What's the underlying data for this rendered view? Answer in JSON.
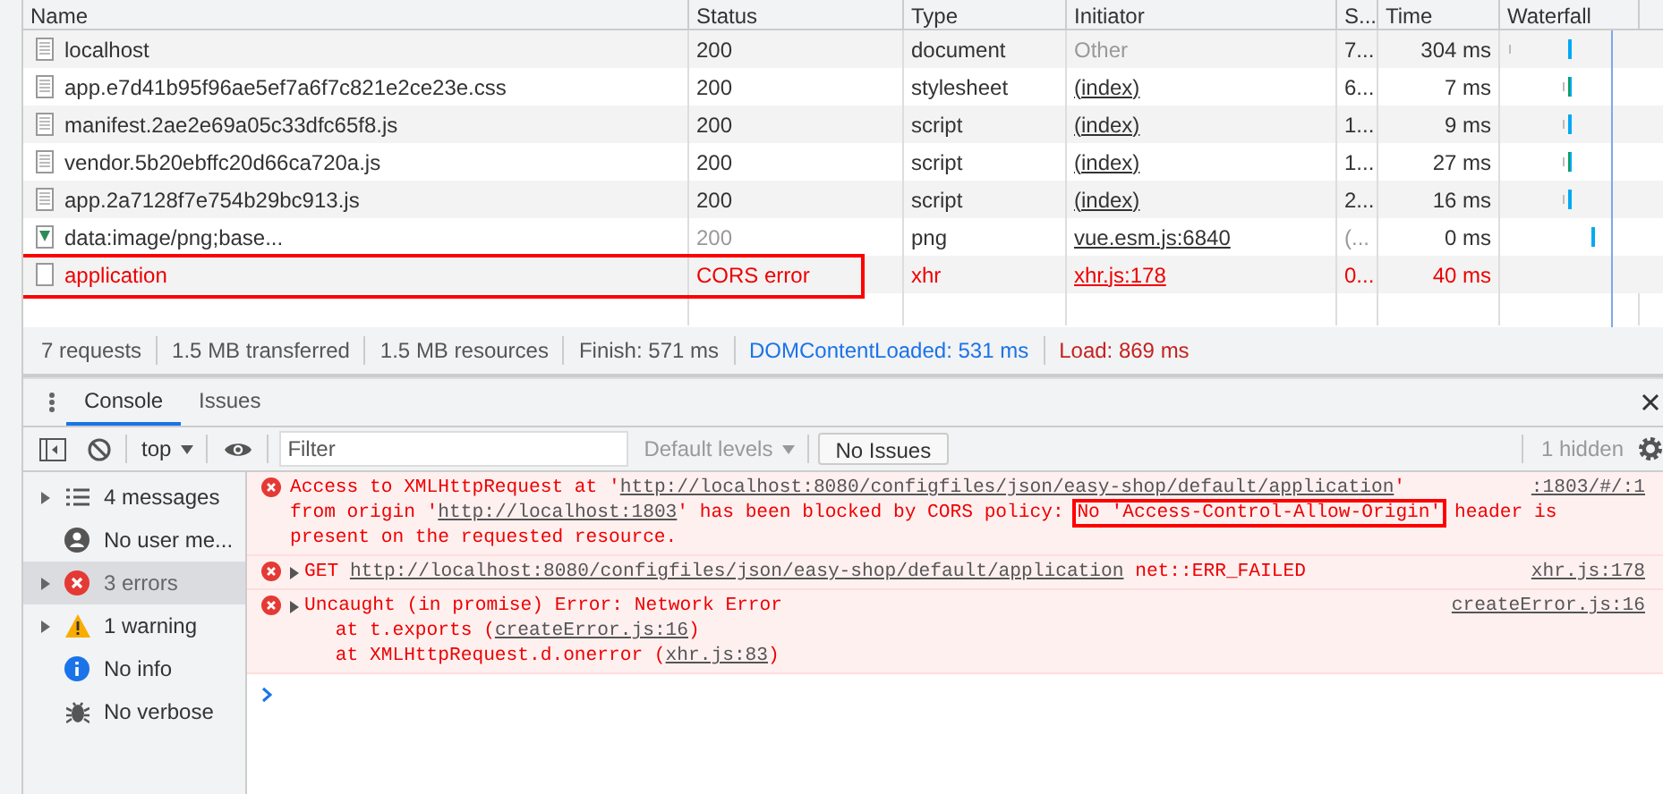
{
  "network": {
    "columns": [
      "Name",
      "Status",
      "Type",
      "Initiator",
      "S...",
      "Time",
      "Waterfall"
    ],
    "rows": [
      {
        "name": "localhost",
        "status": "200",
        "type": "document",
        "initiator": "Other",
        "initiator_link": false,
        "size": "7...",
        "time": "304 ms",
        "kind": "normal",
        "highlighted": false
      },
      {
        "name": "app.e7d41b95f96ae5ef7a6f7c821e2ce23e.css",
        "status": "200",
        "type": "stylesheet",
        "initiator": "(index)",
        "initiator_link": true,
        "size": "6...",
        "time": "7 ms",
        "kind": "normal",
        "highlighted": false
      },
      {
        "name": "manifest.2ae2e69a05c33dfc65f8.js",
        "status": "200",
        "type": "script",
        "initiator": "(index)",
        "initiator_link": true,
        "size": "1...",
        "time": "9 ms",
        "kind": "normal",
        "highlighted": false
      },
      {
        "name": "vendor.5b20ebffc20d66ca720a.js",
        "status": "200",
        "type": "script",
        "initiator": "(index)",
        "initiator_link": true,
        "size": "1...",
        "time": "27 ms",
        "kind": "normal",
        "highlighted": false
      },
      {
        "name": "app.2a7128f7e754b29bc913.js",
        "status": "200",
        "type": "script",
        "initiator": "(index)",
        "initiator_link": true,
        "size": "2...",
        "time": "16 ms",
        "kind": "normal",
        "highlighted": false
      },
      {
        "name": "data:image/png;base...",
        "status": "200",
        "type": "png",
        "initiator": "vue.esm.js:6840",
        "initiator_link": true,
        "size": "(...",
        "time": "0 ms",
        "kind": "memory",
        "highlighted": false
      },
      {
        "name": "application",
        "status": "CORS error",
        "type": "xhr",
        "initiator": "xhr.js:178",
        "initiator_link": true,
        "size": "0...",
        "time": "40 ms",
        "kind": "error",
        "highlighted": true
      }
    ],
    "summary": [
      {
        "text": "7 requests",
        "kind": "plain"
      },
      {
        "text": "1.5 MB transferred",
        "kind": "plain"
      },
      {
        "text": "1.5 MB resources",
        "kind": "plain"
      },
      {
        "text": "Finish: 571 ms",
        "kind": "plain"
      },
      {
        "text": "DOMContentLoaded: 531 ms",
        "kind": "dom"
      },
      {
        "text": "Load: 869 ms",
        "kind": "load"
      }
    ]
  },
  "drawer": {
    "tabs": [
      {
        "label": "Console",
        "selected": true
      },
      {
        "label": "Issues",
        "selected": false
      }
    ]
  },
  "toolbar": {
    "context": "top",
    "filter_placeholder": "Filter",
    "levels": "Default levels",
    "issues": "No Issues",
    "hidden": "1 hidden"
  },
  "sidebar": [
    {
      "label": "4 messages",
      "kind": "list",
      "expandable": true,
      "selected": false
    },
    {
      "label": "No user me...",
      "kind": "user",
      "expandable": false,
      "selected": false
    },
    {
      "label": "3 errors",
      "kind": "error",
      "expandable": true,
      "selected": true
    },
    {
      "label": "1 warning",
      "kind": "warning",
      "expandable": true,
      "selected": false
    },
    {
      "label": "No info",
      "kind": "info",
      "expandable": false,
      "selected": false
    },
    {
      "label": "No verbose",
      "kind": "bug",
      "expandable": false,
      "selected": false
    }
  ],
  "messages": [
    {
      "expandable": false,
      "source": ":1803/#/:1",
      "lines": [
        [
          {
            "text": "Access to XMLHttpRequest at '",
            "kind": "plain"
          },
          {
            "text": "http://localhost:8080/configfiles/json/easy-shop/default/application",
            "kind": "link"
          },
          {
            "text": "'",
            "kind": "plain"
          }
        ],
        [
          {
            "text": "from origin '",
            "kind": "plain"
          },
          {
            "text": "http://localhost:1803",
            "kind": "link"
          },
          {
            "text": "' has been blocked by CORS policy: ",
            "kind": "plain"
          },
          {
            "text": "No 'Access-Control-Allow-Origin'",
            "kind": "highlight"
          },
          {
            "text": " header is",
            "kind": "plain"
          }
        ],
        [
          {
            "text": "present on the requested resource.",
            "kind": "plain"
          }
        ]
      ]
    },
    {
      "expandable": true,
      "source": "xhr.js:178",
      "lines": [
        [
          {
            "text": "GET ",
            "kind": "plain"
          },
          {
            "text": "http://localhost:8080/configfiles/json/easy-shop/default/application",
            "kind": "link"
          },
          {
            "text": " net::ERR_FAILED",
            "kind": "plain"
          }
        ]
      ]
    },
    {
      "expandable": true,
      "source": "createError.js:16",
      "lines": [
        [
          {
            "text": "Uncaught (in promise) Error: Network Error",
            "kind": "plain"
          }
        ],
        [
          {
            "text": "    at t.exports (",
            "kind": "plain"
          },
          {
            "text": "createError.js:16",
            "kind": "link"
          },
          {
            "text": ")",
            "kind": "plain"
          }
        ],
        [
          {
            "text": "    at XMLHttpRequest.d.onerror (",
            "kind": "plain"
          },
          {
            "text": "xhr.js:83",
            "kind": "link"
          },
          {
            "text": ")",
            "kind": "plain"
          }
        ]
      ]
    }
  ]
}
